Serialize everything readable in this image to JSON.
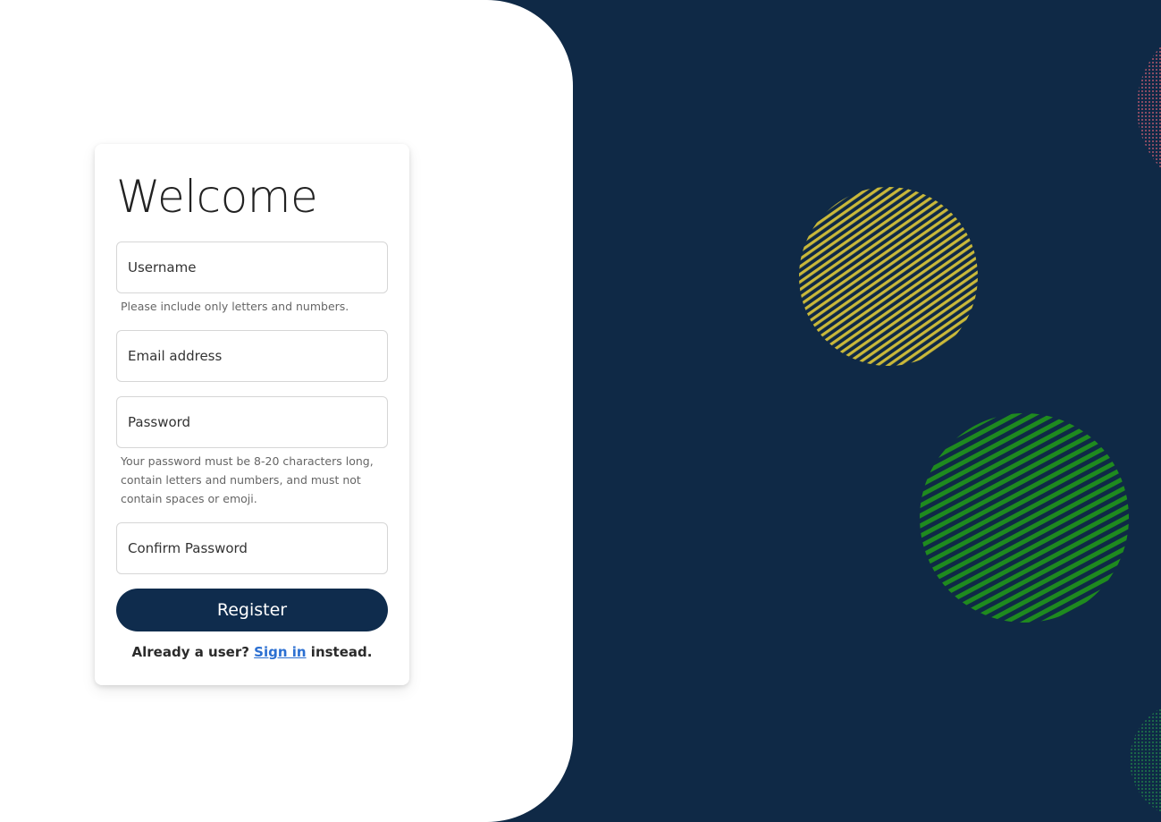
{
  "form": {
    "title": "Welcome",
    "username_placeholder": "Username",
    "username_hint": "Please include only letters and numbers.",
    "email_placeholder": "Email address",
    "password_placeholder": "Password",
    "password_hint": "Your password must be 8-20 characters long, contain letters and numbers, and must not contain spaces or emoji.",
    "confirm_placeholder": "Confirm Password",
    "register_label": "Register",
    "signin_prefix": "Already a user? ",
    "signin_link": "Sign in",
    "signin_suffix": " instead."
  },
  "colors": {
    "background": "#0f2946",
    "button": "#0f2c4d",
    "link": "#2b6fd1",
    "circle_yellow": "#c9b83a",
    "circle_green": "#1f8a1f",
    "circle_pink": "#b0566a",
    "circle_teal": "#1e7a4a"
  }
}
